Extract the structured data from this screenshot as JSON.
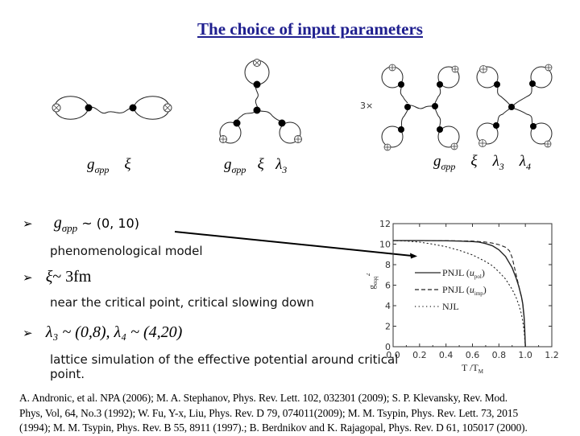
{
  "slide": {
    "title": "The choice of input parameters"
  },
  "diagrams": [
    {
      "name": "two-point",
      "labels": {
        "g": "g",
        "g_sub": "σpp",
        "xi": "ξ"
      }
    },
    {
      "name": "three-point",
      "labels": {
        "g": "g",
        "g_sub": "σpp",
        "xi": "ξ",
        "lambda": "λ",
        "lambda_sub": "3"
      }
    },
    {
      "name": "four-point",
      "multiplier": "3×",
      "labels": {
        "g": "g",
        "g_sub": "σpp",
        "xi": "ξ",
        "lambda3": "λ",
        "lambda3_sub": "3",
        "lambda4": "λ",
        "lambda4_sub": "4"
      }
    }
  ],
  "bullets": [
    {
      "marker": "➢",
      "math_symbol": "g",
      "math_sub": "σpp",
      "math_rest": " ~ (0, 10)",
      "description": "phenomenological  model"
    },
    {
      "marker": "➢",
      "math_symbol": "ξ",
      "math_rest": "~ 3fm",
      "description": "near the critical point, critical slowing down"
    },
    {
      "marker": "➢",
      "math_text": "λ₃ ~ (0,8),  λ₄ ~ (4,20)",
      "description_line1": "lattice simulation of the effective potential around critical",
      "description_line2": "point."
    }
  ],
  "references": [
    "A. Andronic, et al.  NPA (2006);      M. A. Stephanov, Phys. Rev. Lett. 102, 032301 (2009);  S. P. Klevansky, Rev. Mod.",
    "Phys, Vol, 64, No.3 (1992); W. Fu, Y-x, Liu, Phys. Rev. D 79, 074011(2009);  M. M. Tsypin, Phys. Rev. Lett. 73, 2015",
    "(1994); M. M. Tsypin, Phys. Rev. B 55, 8911 (1997).;  B. Berdnikov and K. Rajagopal, Phys. Rev. D 61, 105017 (2000)."
  ],
  "chart_data": {
    "type": "line",
    "title": "",
    "xlabel": "T /T",
    "xlabel_sub": "M",
    "ylabel": "g",
    "ylabel_sub": "σqq",
    "ylabel_sup": "2",
    "xlim": [
      0.0,
      1.2
    ],
    "ylim": [
      0,
      12
    ],
    "xticks": [
      "0.0",
      "0.2",
      "0.4",
      "0.6",
      "0.8",
      "1.0",
      "1.2"
    ],
    "yticks": [
      "0",
      "2",
      "4",
      "6",
      "8",
      "10",
      "12"
    ],
    "grid": false,
    "legend_position": "center-left",
    "series": [
      {
        "name": "PNJL (u_pol)",
        "legend_main": "PNJL (",
        "legend_sym": "u",
        "legend_sub": "pol",
        "legend_close": ")",
        "style": "solid",
        "color": "#222222",
        "x": [
          0.0,
          0.2,
          0.4,
          0.5,
          0.6,
          0.65,
          0.7,
          0.75,
          0.8,
          0.85,
          0.9,
          0.93,
          0.95,
          0.97,
          0.98,
          0.99,
          0.995,
          1.0
        ],
        "y": [
          10.35,
          10.35,
          10.33,
          10.3,
          10.25,
          10.2,
          10.05,
          9.85,
          9.45,
          8.8,
          7.7,
          6.7,
          5.9,
          4.9,
          4.2,
          3.0,
          1.8,
          0.0
        ]
      },
      {
        "name": "PNJL (u_imp)",
        "legend_main": "PNJL (",
        "legend_sym": "u",
        "legend_sub": "imp",
        "legend_close": ")",
        "style": "dashed",
        "color": "#222222",
        "x": [
          0.0,
          0.2,
          0.4,
          0.5,
          0.6,
          0.7,
          0.75,
          0.8,
          0.85,
          0.88,
          0.9,
          0.92,
          0.94,
          0.96,
          0.98,
          0.99,
          1.0
        ],
        "y": [
          10.35,
          10.35,
          10.34,
          10.32,
          10.3,
          10.2,
          10.1,
          9.95,
          9.7,
          9.35,
          8.7,
          7.6,
          6.5,
          5.4,
          4.3,
          2.8,
          0.0
        ]
      },
      {
        "name": "NJL",
        "legend_main": "NJL",
        "style": "dotted",
        "color": "#222222",
        "x": [
          0.0,
          0.1,
          0.2,
          0.3,
          0.4,
          0.5,
          0.6,
          0.7,
          0.75,
          0.8,
          0.85,
          0.9,
          0.93,
          0.95,
          0.97,
          0.98,
          0.99,
          1.0
        ],
        "y": [
          10.35,
          10.3,
          10.2,
          10.0,
          9.75,
          9.4,
          8.95,
          8.3,
          7.9,
          7.3,
          6.6,
          5.6,
          4.8,
          4.1,
          3.2,
          2.5,
          1.6,
          0.0
        ]
      }
    ],
    "annotation_arrow": {
      "from": "bullet-g-sigma-pp",
      "to": "y≈9 at x≈0.1"
    }
  }
}
